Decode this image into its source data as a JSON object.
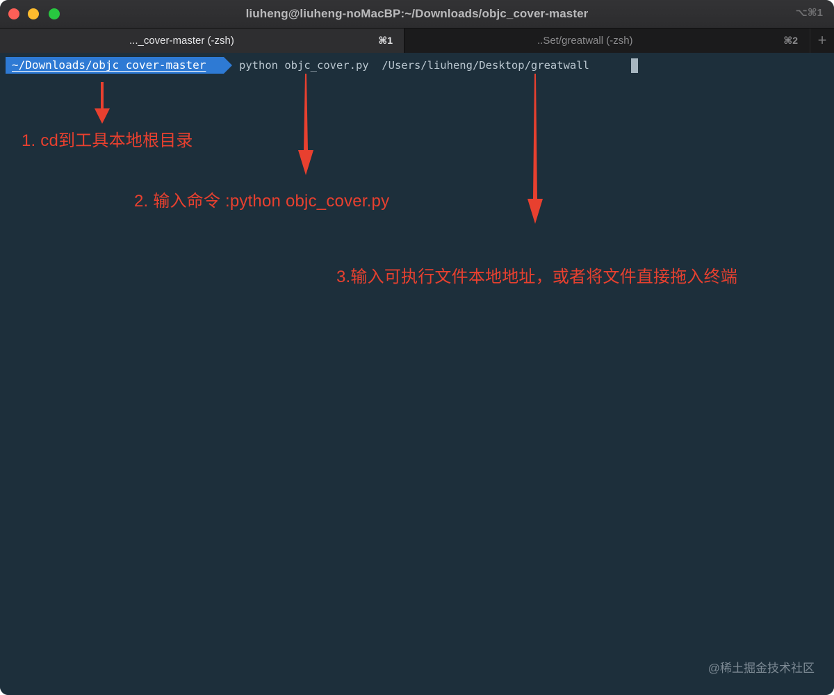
{
  "window": {
    "title": "liuheng@liuheng-noMacBP:~/Downloads/objc_cover-master",
    "title_shortcut": "⌥⌘1"
  },
  "tabs": [
    {
      "label": "..._cover-master (-zsh)",
      "shortcut": "⌘1",
      "active": true
    },
    {
      "label": "..Set/greatwall (-zsh)",
      "shortcut": "⌘2",
      "active": false
    }
  ],
  "new_tab_glyph": "+",
  "terminal": {
    "prompt_path": "~/Downloads/objc_cover-master",
    "command": "python objc_cover.py  /Users/liuheng/Desktop/greatwall "
  },
  "annotations": {
    "step1": "1. cd到工具本地根目录",
    "step2": "2. 输入命令 :python objc_cover.py",
    "step3": "3.输入可执行文件本地地址，或者将文件直接拖入终端"
  },
  "watermark": "@稀土掘金技术社区",
  "colors": {
    "terminal_bg": "#1d2f3b",
    "prompt_bg": "#2e7ad4",
    "annotation": "#e8402f"
  }
}
